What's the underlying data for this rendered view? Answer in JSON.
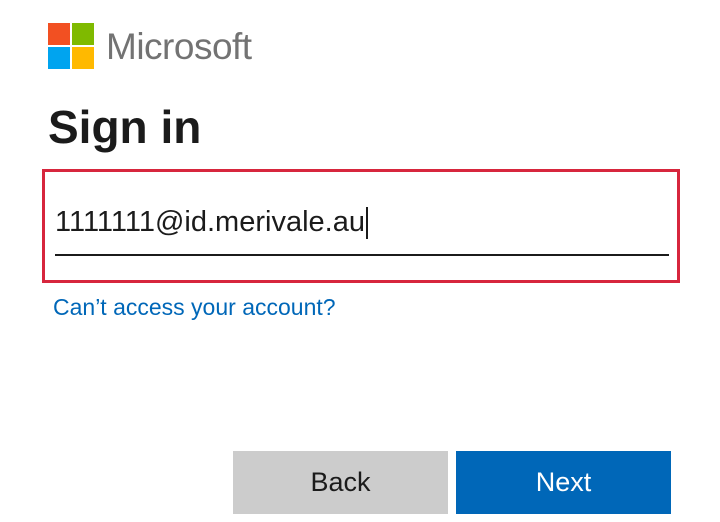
{
  "brand": {
    "name": "Microsoft",
    "logo_colors": [
      "#f25022",
      "#7fba00",
      "#00a4ef",
      "#ffb900"
    ]
  },
  "signin": {
    "title": "Sign in",
    "email_value": "1111111@id.merivale.au",
    "help_link": "Can’t access your account?"
  },
  "buttons": {
    "back_label": "Back",
    "next_label": "Next"
  },
  "colors": {
    "accent": "#0067b8",
    "highlight": "#d7263d",
    "back_button": "#cccccc"
  }
}
